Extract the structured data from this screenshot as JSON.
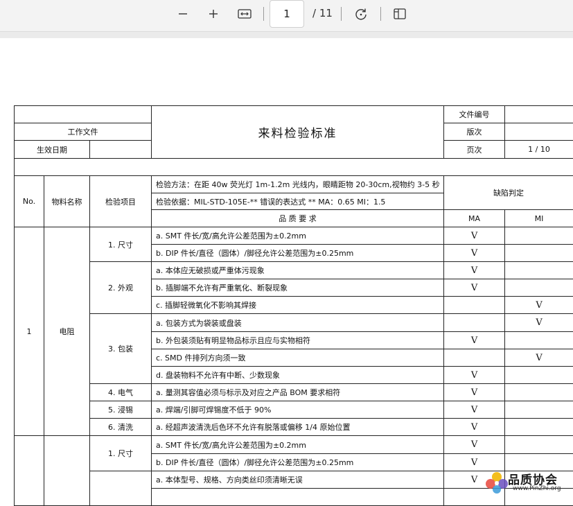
{
  "toolbar": {
    "current_page": "1",
    "total_pages": "/ 11"
  },
  "doc": {
    "title": "来料检验标准",
    "work_file": "工作文件",
    "effective_date": "生效日期",
    "file_no": "文件编号",
    "version": "版次",
    "page_label": "页次",
    "page_value": "1 / 10",
    "col_no": "No.",
    "col_material": "物料名称",
    "col_item": "检验项目",
    "method": "检验方法：在距 40w 荧光灯 1m-1.2m 光线内，眼睛距物 20-30cm,视物约 3-5 秒",
    "basis": "检验依据：MIL-STD-105E-** 错误的表达式 **   MA：0.65  MI：1.5",
    "quality": "品   质   要   求",
    "defect": "缺陷判定",
    "ma": "MA",
    "mi": "MI",
    "row_no": "1",
    "material": "电阻"
  },
  "rows": [
    {
      "item": "1. 尺寸",
      "req": "a. SMT 件长/宽/高允许公差范围为±0.2mm",
      "ma": "V",
      "mi": ""
    },
    {
      "item": "",
      "req": "b. DIP 件长/直径（圆体）/脚径允许公差范围为±0.25mm",
      "ma": "V",
      "mi": ""
    },
    {
      "item": "2. 外观",
      "req": "a. 本体应无破损或严重体污现象",
      "ma": "V",
      "mi": ""
    },
    {
      "item": "",
      "req": "b. 插脚端不允许有严重氧化、断裂现象",
      "ma": "V",
      "mi": ""
    },
    {
      "item": "",
      "req": "c. 插脚轻微氧化不影响其焊接",
      "ma": "",
      "mi": "V"
    },
    {
      "item": "3. 包装",
      "req": "a. 包装方式为袋装或盘装",
      "ma": "",
      "mi": "V"
    },
    {
      "item": "",
      "req": "b. 外包装须贴有明显物品标示且应与实物相符",
      "ma": "V",
      "mi": ""
    },
    {
      "item": "",
      "req": "c. SMD 件排列方向须一致",
      "ma": "",
      "mi": "V"
    },
    {
      "item": "",
      "req": "d. 盘装物料不允许有中断、少数现象",
      "ma": "V",
      "mi": ""
    },
    {
      "item": "4. 电气",
      "req": "a. 量测其容值必须与标示及对应之产品 BOM 要求相符",
      "ma": "V",
      "mi": ""
    },
    {
      "item": "5. 浸锡",
      "req": "a. 焊端/引脚可焊锡度不低于 90%",
      "ma": "V",
      "mi": ""
    },
    {
      "item": "6. 清洗",
      "req": "a. 经超声波清洗后色环不允许有脱落或偏移 1/4 原始位置",
      "ma": "V",
      "mi": ""
    },
    {
      "item": "1. 尺寸",
      "req": "a. SMT 件长/宽/高允许公差范围为±0.2mm",
      "ma": "V",
      "mi": ""
    },
    {
      "item": "",
      "req": "b. DIP 件长/直径（圆体）/脚径允许公差范围为±0.25mm",
      "ma": "V",
      "mi": ""
    },
    {
      "item": "",
      "req": "a. 本体型号、规格、方向类丝印须清晰无误",
      "ma": "V",
      "mi": ""
    }
  ],
  "watermark": {
    "text": "品质协会",
    "url": "www.PinZhi.org"
  }
}
